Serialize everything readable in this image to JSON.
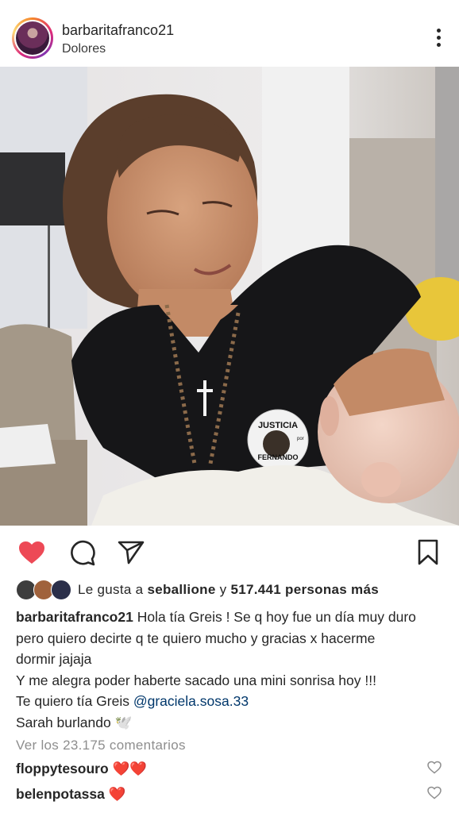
{
  "post": {
    "username": "barbaritafranco21",
    "location": "Dolores",
    "likes_prefix": "Le gusta a",
    "likes_user": "seballione",
    "likes_join": "y",
    "likes_count": "517.441 personas más",
    "caption_user": "barbaritafranco21",
    "caption_lines": [
      "Hola tía Greis ! Se q hoy fue un día muy duro",
      "pero quiero decirte q te quiero mucho y gracias x hacerme",
      "dormir jajaja",
      "Y me alegra poder haberte sacado una mini sonrisa hoy !!!",
      "Te quiero tía Greis",
      "Sarah burlando 🕊️"
    ],
    "caption_mention": "@graciela.sosa.33",
    "view_comments": "Ver los 23.175 comentarios",
    "comments": [
      {
        "user": "floppytesouro",
        "text": "❤️❤️"
      },
      {
        "user": "belenpotassa",
        "text": "❤️"
      }
    ],
    "badge_text_top": "JUSTICIA",
    "badge_text_bottom": "FERNANDO",
    "badge_text_por": "por"
  },
  "icons": {
    "like": "heart-filled-icon",
    "comment": "comment-bubble-icon",
    "share": "paper-plane-icon",
    "save": "bookmark-icon",
    "more": "more-vertical-icon"
  },
  "colors": {
    "like_red": "#ed4956",
    "mention_blue": "#00376b",
    "muted_gray": "#8e8e8e"
  }
}
